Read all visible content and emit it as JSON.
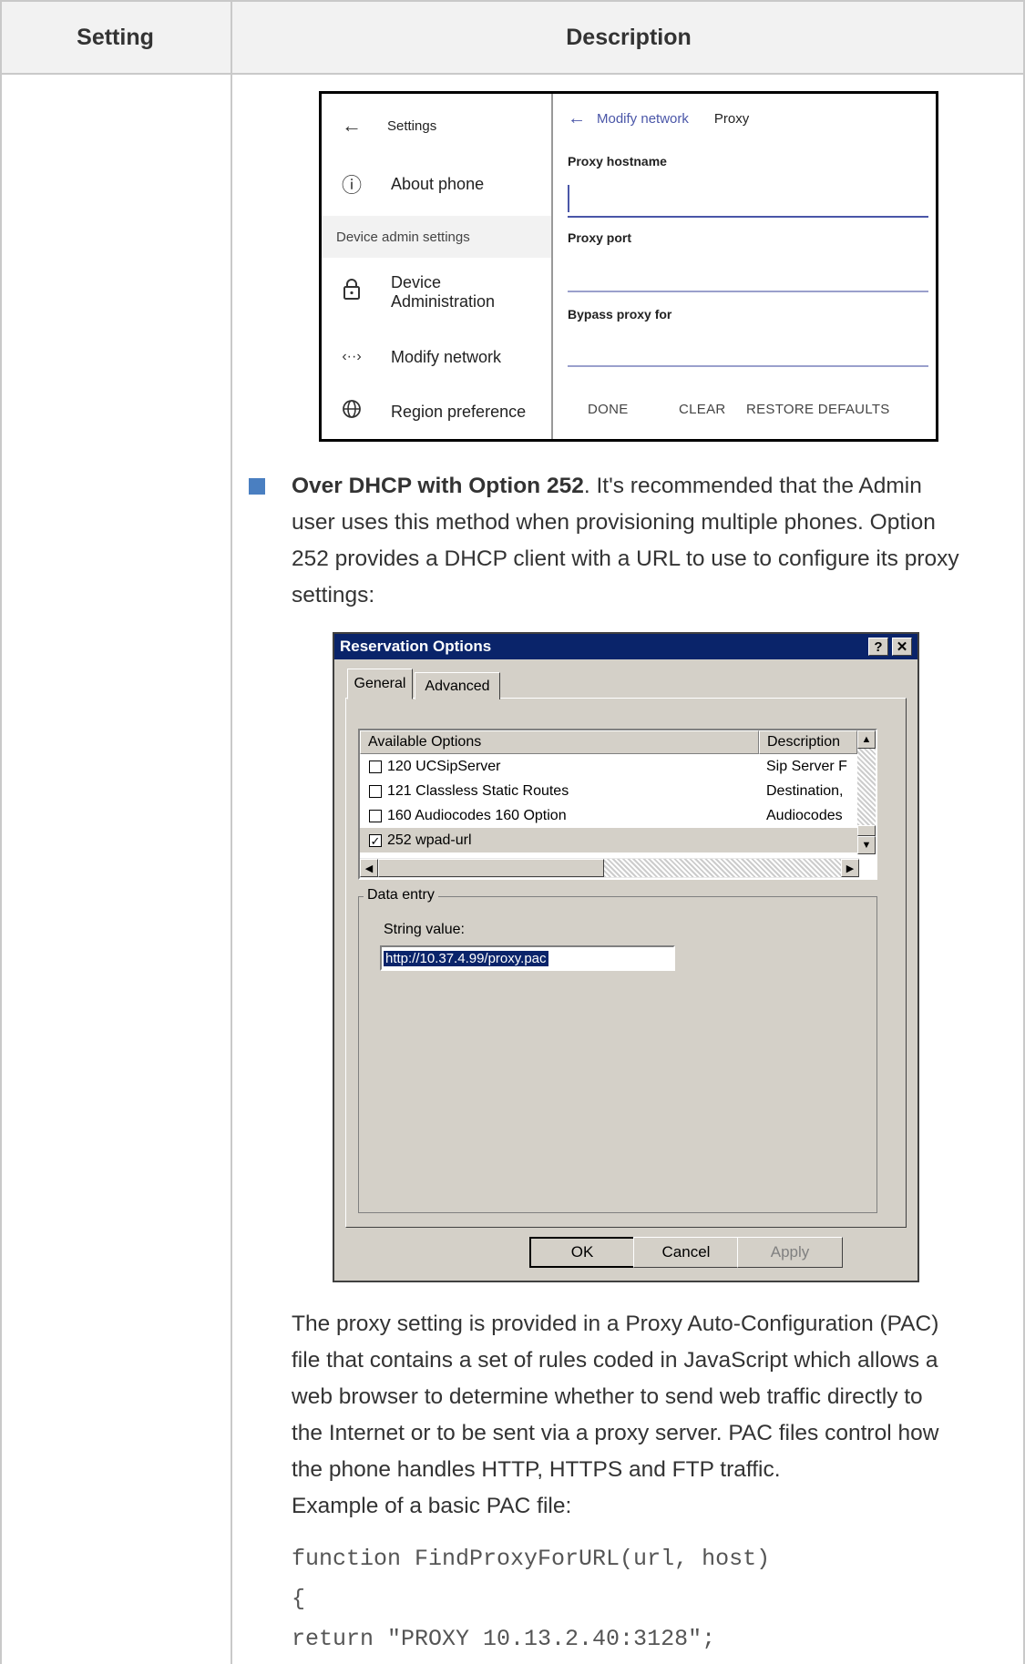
{
  "table": {
    "header": {
      "setting": "Setting",
      "description": "Description"
    }
  },
  "phone": {
    "left": {
      "back_icon": "arrow-left-icon",
      "title": "Settings",
      "about": "About phone",
      "section": "Device admin settings",
      "device_admin_line1": "Device",
      "device_admin_line2": "Administration",
      "modify_network": "Modify network",
      "region": "Region preference"
    },
    "right": {
      "breadcrumb_parent": "Modify network",
      "breadcrumb_current": "Proxy",
      "hostname_label": "Proxy hostname",
      "port_label": "Proxy port",
      "bypass_label": "Bypass proxy for",
      "done": "DONE",
      "clear": "CLEAR",
      "restore": "RESTORE DEFAULTS"
    }
  },
  "bullet": {
    "bold": "Over DHCP with Option 252",
    "text_line1": ". It's recommended that the Admin",
    "line2": "user uses this method when provisioning multiple phones. Option",
    "line3": "252 provides a DHCP client with a URL to use to configure its proxy",
    "line4": "settings:"
  },
  "dialog": {
    "title": "Reservation Options",
    "help_btn": "?",
    "close_btn": "✕",
    "tabs": [
      "General",
      "Advanced"
    ],
    "columns": [
      "Available Options",
      "Description"
    ],
    "rows": [
      {
        "checked": false,
        "option": "120 UCSipServer",
        "description": "Sip Server F"
      },
      {
        "checked": false,
        "option": "121 Classless Static Routes",
        "description": "Destination, "
      },
      {
        "checked": false,
        "option": "160 Audiocodes 160 Option",
        "description": "Audiocodes"
      },
      {
        "checked": true,
        "option": "252 wpad-url",
        "description": ""
      }
    ],
    "data_entry_legend": "Data entry",
    "string_label": "String value:",
    "string_value": "http://10.37.4.99/proxy.pac",
    "buttons": {
      "ok": "OK",
      "cancel": "Cancel",
      "apply": "Apply"
    }
  },
  "body": {
    "p1": "The proxy setting is provided in a Proxy Auto-Configuration (PAC)",
    "p2": "file that contains a set of rules coded in JavaScript which allows a",
    "p3": "web browser to determine whether to send web traffic directly to",
    "p4": "the Internet or to be sent via a proxy server. PAC files control how",
    "p5": "the phone handles HTTP, HTTPS and FTP traffic.",
    "example": "Example of a basic PAC file:"
  },
  "code": {
    "line1": "function FindProxyForURL(url, host)",
    "line2": "{",
    "line3": "return \"PROXY 10.13.2.40:3128\";"
  }
}
